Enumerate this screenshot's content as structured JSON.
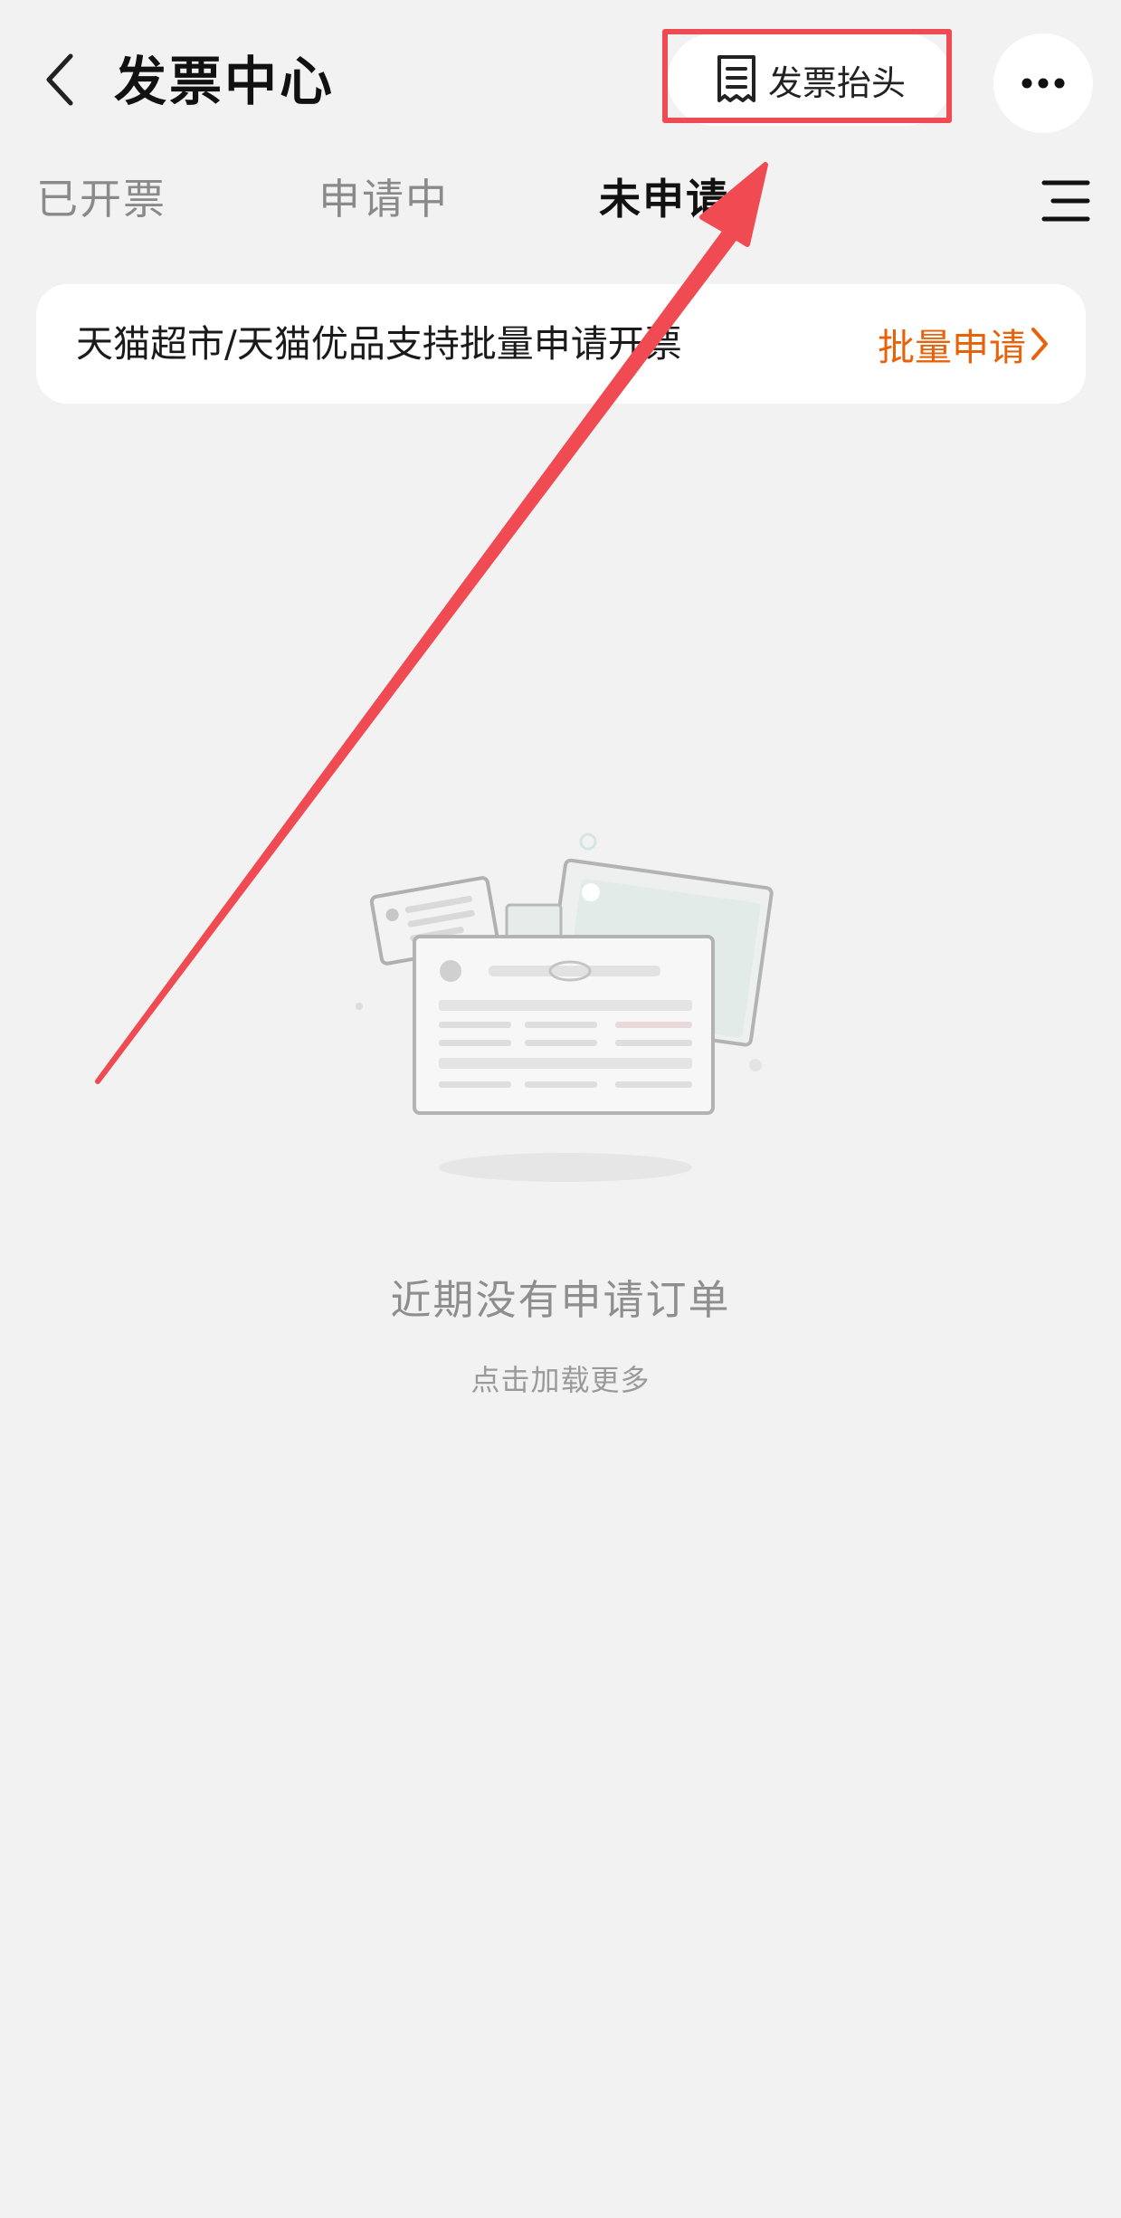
{
  "header": {
    "title": "发票中心",
    "invoice_title_label": "发票抬头",
    "icons": {
      "back": "chevron-left-icon",
      "invoice_title": "document-list-icon",
      "more": "more-dots-icon"
    }
  },
  "tabs": [
    {
      "label": "已开票",
      "active": false
    },
    {
      "label": "申请中",
      "active": false
    },
    {
      "label": "未申请",
      "active": true
    }
  ],
  "filter": {
    "icon": "filter-lines-icon"
  },
  "banner": {
    "text": "天猫超市/天猫优品支持批量申请开票",
    "link_label": "批量申请",
    "link_icon": "chevron-right-icon",
    "link_color": "#e8620a"
  },
  "empty_state": {
    "illustration": "empty-invoice-illustration",
    "title": "近期没有申请订单",
    "load_more": "点击加载更多"
  },
  "annotation": {
    "highlight_color": "#f04a52"
  }
}
